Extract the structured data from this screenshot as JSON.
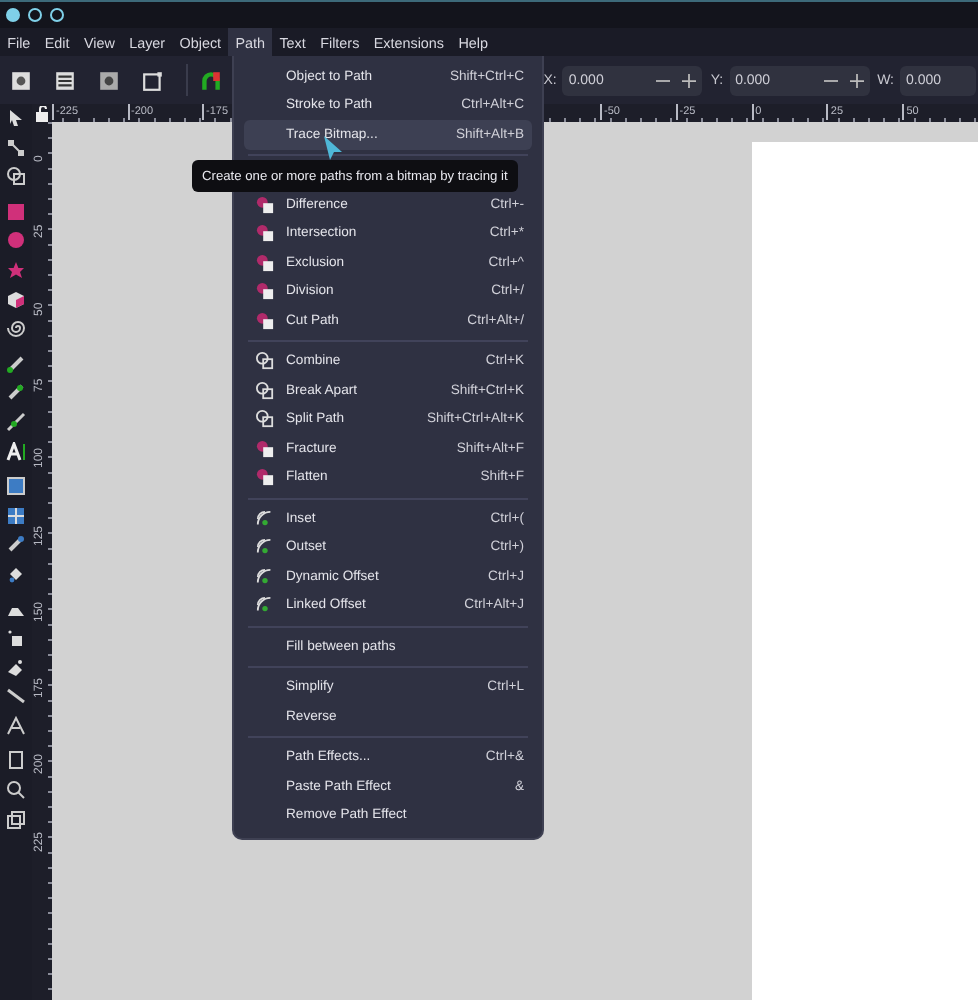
{
  "menu_bar": [
    {
      "label": "File",
      "selected": false
    },
    {
      "label": "Edit",
      "selected": false
    },
    {
      "label": "View",
      "selected": false
    },
    {
      "label": "Layer",
      "selected": false
    },
    {
      "label": "Object",
      "selected": false
    },
    {
      "label": "Path",
      "selected": true
    },
    {
      "label": "Text",
      "selected": false
    },
    {
      "label": "Filters",
      "selected": false
    },
    {
      "label": "Extensions",
      "selected": false
    },
    {
      "label": "Help",
      "selected": false
    }
  ],
  "fields": [
    {
      "label": "X:",
      "value": "0.000",
      "steppers": true
    },
    {
      "label": "Y:",
      "value": "0.000",
      "steppers": true
    },
    {
      "label": "W:",
      "value": "0.000",
      "steppers": false
    }
  ],
  "ruler": {
    "left_labels": [
      "-225",
      "-200",
      "-175"
    ],
    "right_labels": [
      "-50",
      "-25",
      "0",
      "25",
      "50"
    ],
    "vertical_labels": [
      "0",
      "25",
      "50",
      "75",
      "100",
      "125",
      "150",
      "175",
      "200",
      "225"
    ]
  },
  "path_menu": {
    "groups": [
      [
        {
          "label": "Object to Path",
          "shortcut": "Shift+Ctrl+C",
          "kind": "plain",
          "selected": false
        },
        {
          "label": "Stroke to Path",
          "shortcut": "Ctrl+Alt+C",
          "kind": "plain",
          "selected": false
        },
        {
          "label": "Trace Bitmap...",
          "shortcut": "Shift+Alt+B",
          "kind": "plain",
          "selected": true
        }
      ],
      [
        {
          "label": "Difference",
          "shortcut": "Ctrl+-",
          "kind": "shapes",
          "selected": false
        },
        {
          "label": "Intersection",
          "shortcut": "Ctrl+*",
          "kind": "shapes",
          "selected": false
        },
        {
          "label": "Exclusion",
          "shortcut": "Ctrl+^",
          "kind": "shapes",
          "selected": false
        },
        {
          "label": "Division",
          "shortcut": "Ctrl+/",
          "kind": "shapes",
          "selected": false
        },
        {
          "label": "Cut Path",
          "shortcut": "Ctrl+Alt+/",
          "kind": "shapes",
          "selected": false
        }
      ],
      [
        {
          "label": "Combine",
          "shortcut": "Ctrl+K",
          "kind": "outline",
          "selected": false
        },
        {
          "label": "Break Apart",
          "shortcut": "Shift+Ctrl+K",
          "kind": "outline",
          "selected": false
        },
        {
          "label": "Split Path",
          "shortcut": "Shift+Ctrl+Alt+K",
          "kind": "outline",
          "selected": false
        },
        {
          "label": "Fracture",
          "shortcut": "Shift+Alt+F",
          "kind": "shapes",
          "selected": false
        },
        {
          "label": "Flatten",
          "shortcut": "Shift+F",
          "kind": "shapes",
          "selected": false
        }
      ],
      [
        {
          "label": "Inset",
          "shortcut": "Ctrl+(",
          "kind": "arcs",
          "selected": false
        },
        {
          "label": "Outset",
          "shortcut": "Ctrl+)",
          "kind": "arcs",
          "selected": false
        },
        {
          "label": "Dynamic Offset",
          "shortcut": "Ctrl+J",
          "kind": "arcs",
          "selected": false
        },
        {
          "label": "Linked Offset",
          "shortcut": "Ctrl+Alt+J",
          "kind": "arcs",
          "selected": false
        }
      ],
      [
        {
          "label": "Fill between paths",
          "kind": "plain",
          "selected": false
        }
      ],
      [
        {
          "label": "Simplify",
          "shortcut": "Ctrl+L",
          "kind": "plain",
          "selected": false
        },
        {
          "label": "Reverse",
          "kind": "plain",
          "selected": false
        }
      ],
      [
        {
          "label": "Path Effects...",
          "shortcut": "Ctrl+&",
          "kind": "plain",
          "selected": false
        },
        {
          "label": "Paste Path Effect",
          "shortcut": "&",
          "kind": "plain",
          "selected": false
        },
        {
          "label": "Remove Path Effect",
          "kind": "plain",
          "selected": false
        }
      ]
    ]
  },
  "tooltip": "Create one or more paths from a bitmap by tracing it"
}
